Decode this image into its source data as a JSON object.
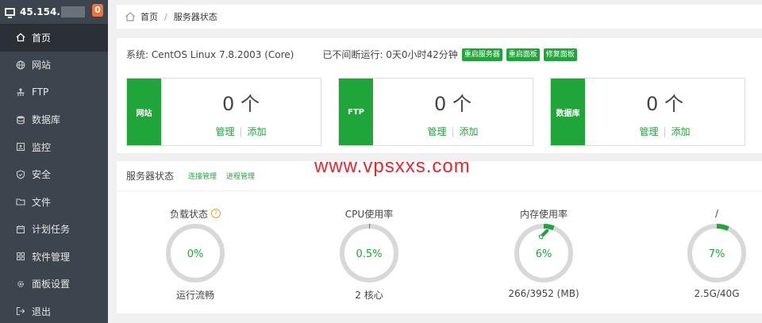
{
  "sidebar": {
    "ip": "45.154.",
    "badge": "0",
    "items": [
      {
        "label": "首页",
        "icon": "home-icon"
      },
      {
        "label": "网站",
        "icon": "globe-icon"
      },
      {
        "label": "FTP",
        "icon": "ftp-icon"
      },
      {
        "label": "数据库",
        "icon": "database-icon"
      },
      {
        "label": "监控",
        "icon": "monitor-icon"
      },
      {
        "label": "安全",
        "icon": "shield-icon"
      },
      {
        "label": "文件",
        "icon": "folder-icon"
      },
      {
        "label": "计划任务",
        "icon": "calendar-icon"
      },
      {
        "label": "软件管理",
        "icon": "grid-icon"
      },
      {
        "label": "面板设置",
        "icon": "gear-icon"
      },
      {
        "label": "退出",
        "icon": "logout-icon"
      }
    ]
  },
  "breadcrumb": {
    "home": "首页",
    "separator": "/",
    "current": "服务器状态"
  },
  "system": {
    "os": "系统: CentOS Linux 7.8.2003 (Core)",
    "uptime": "已不间断运行: 0天0小时42分钟",
    "buttons": [
      "重启服务器",
      "重启面板",
      "修复面板"
    ]
  },
  "stats": [
    {
      "label": "网站",
      "count": "0 个",
      "manage": "管理",
      "add": "添加"
    },
    {
      "label": "FTP",
      "count": "0 个",
      "manage": "管理",
      "add": "添加"
    },
    {
      "label": "数据库",
      "count": "0 个",
      "manage": "管理",
      "add": "添加"
    }
  ],
  "status": {
    "title": "服务器状态",
    "links": [
      "连接管理",
      "进程管理"
    ],
    "gauges": [
      {
        "title": "负载状态",
        "value": "0%",
        "percent": 0,
        "footer": "运行流畅"
      },
      {
        "title": "CPU使用率",
        "value": "0.5%",
        "percent": 0.5,
        "footer": "2 核心"
      },
      {
        "title": "内存使用率",
        "value": "6%",
        "percent": 6,
        "footer": "266/3952 (MB)"
      },
      {
        "title": "/",
        "value": "7%",
        "percent": 7,
        "footer": "2.5G/40G"
      }
    ]
  },
  "watermark": "www.vpsxxs.com",
  "colors": {
    "accent": "#20a53a",
    "sidebar": "#3c444d",
    "badge": "#f0733a",
    "watermark": "#e8262b"
  }
}
